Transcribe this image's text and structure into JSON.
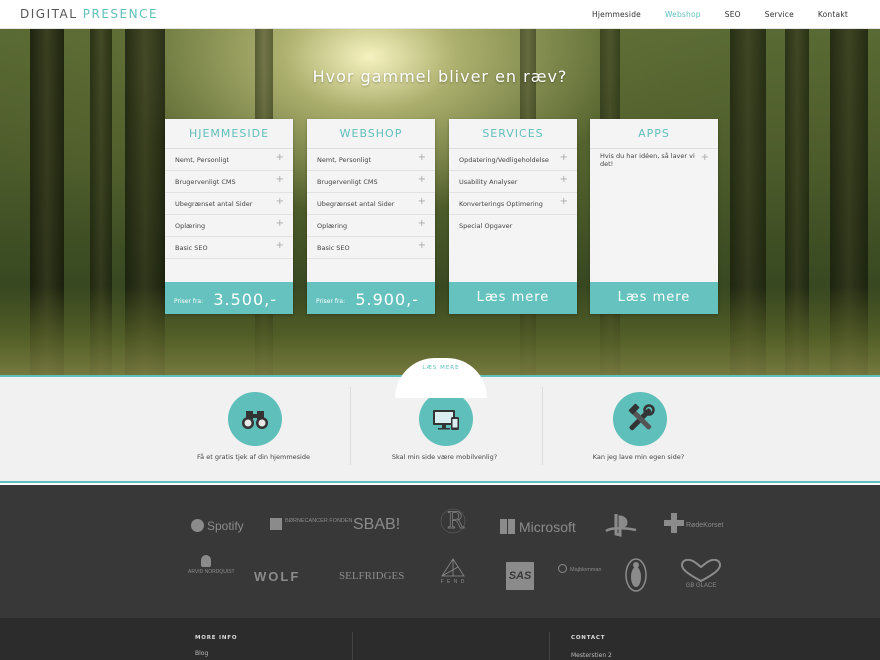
{
  "header": {
    "logo_part1": "DIGITAL",
    "logo_part2": "PRESENCE",
    "nav": [
      "Hjemmeside",
      "Webshop",
      "SEO",
      "Service",
      "Kontakt"
    ],
    "active_nav": "Webshop",
    "accent_color": "#5fbfbb"
  },
  "hero": {
    "title": "Hvor gammel bliver en ræv?"
  },
  "cards": [
    {
      "title": "HJEMMESIDE",
      "items": [
        "Nemt, Personligt",
        "Brugervenligt CMS",
        "Ubegrænset antal Sider",
        "Oplæring",
        "Basic SEO"
      ],
      "footer_from": "Priser fra:",
      "footer_price": "3.500,-"
    },
    {
      "title": "WEBSHOP",
      "items": [
        "Nemt, Personligt",
        "Brugervenligt CMS",
        "Ubegrænset antal Sider",
        "Oplæring",
        "Basic SEO"
      ],
      "footer_from": "Priser fra:",
      "footer_price": "5.900,-"
    },
    {
      "title": "SERVICES",
      "items": [
        "Opdatering/Vedligeholdelse",
        "Usability Analyser",
        "Konverterings Optimering",
        "Special Opgaver"
      ],
      "footer_more": "Læs mere"
    },
    {
      "title": "APPS",
      "items": [
        "Hvis du har idéen, så laver vi det!"
      ],
      "footer_more": "Læs mere"
    }
  ],
  "info": {
    "tab_label": "LÆS MERE",
    "items": [
      {
        "icon": "binoculars-icon",
        "label": "Få et gratis tjek af din hjemmeside"
      },
      {
        "icon": "responsive-devices-icon",
        "label": "Skal min side være mobilvenlig?"
      },
      {
        "icon": "tools-icon",
        "label": "Kan jeg lave min egen side?"
      }
    ]
  },
  "logos": {
    "row1": [
      "Spotify",
      "BØRNECANCER FONDEN",
      "SBAB!",
      "Microsoft",
      "RødeKorset"
    ],
    "row2": [
      "ARVID NORDQUIST",
      "WOLF",
      "SELFRIDGES",
      "F E N D",
      "SAS",
      "Majblomman",
      "GB GLACE"
    ]
  },
  "footer": {
    "more_info_heading": "MORE INFO",
    "more_info_link": "Blog",
    "contact_heading": "CONTACT",
    "contact_address": "Mesterstien 2"
  }
}
